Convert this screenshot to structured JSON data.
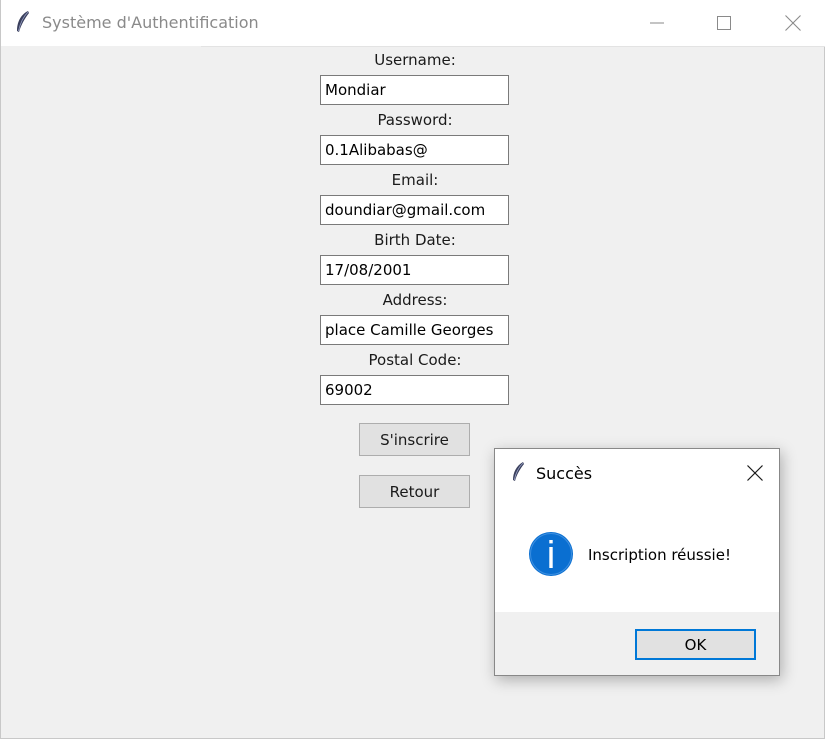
{
  "window": {
    "title": "Système d'Authentification"
  },
  "form": {
    "fields": [
      {
        "label": "Username:",
        "value": "Mondiar"
      },
      {
        "label": "Password:",
        "value": "0.1Alibabas@"
      },
      {
        "label": "Email:",
        "value": "doundiar@gmail.com"
      },
      {
        "label": "Birth Date:",
        "value": "17/08/2001"
      },
      {
        "label": "Address:",
        "value": "place Camille Georges"
      },
      {
        "label": "Postal Code:",
        "value": "69002"
      }
    ],
    "register_button": "S'inscrire",
    "back_button": "Retour"
  },
  "dialog": {
    "title": "Succès",
    "message": "Inscription réussie!",
    "ok_button": "OK"
  },
  "colors": {
    "accent": "#0078d7",
    "info_icon": "#0a6fd1",
    "window_bg": "#f0f0f0"
  },
  "icons": {
    "app": "feather-icon",
    "info": "info-icon"
  }
}
